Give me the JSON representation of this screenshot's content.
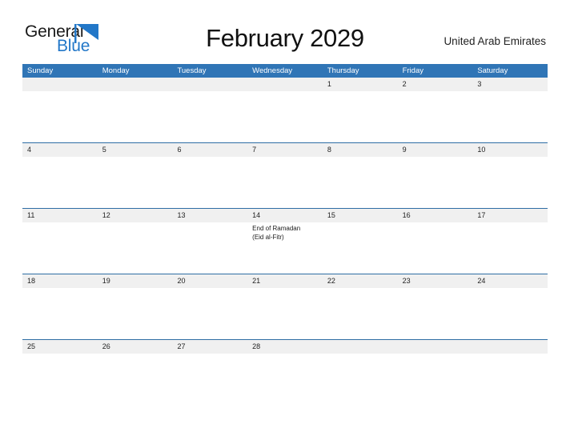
{
  "brand": {
    "name_dark": "General",
    "name_blue": "Blue",
    "flag_icon": "blue-triangle-flag",
    "dark_color": "#1a1a1a",
    "blue_color": "#2277c8"
  },
  "header": {
    "title": "February 2029",
    "country": "United Arab Emirates"
  },
  "theme": {
    "header_blue": "#3075b6",
    "row_divider_blue": "#2e6da4",
    "band_gray": "#f0f0f0",
    "page_background": "#ffffff"
  },
  "calendar": {
    "month": "February",
    "year": "2029",
    "weekdays": [
      "Sunday",
      "Monday",
      "Tuesday",
      "Wednesday",
      "Thursday",
      "Friday",
      "Saturday"
    ],
    "weeks": [
      {
        "days": [
          {
            "number": "",
            "empty": true,
            "events": []
          },
          {
            "number": "",
            "empty": true,
            "events": []
          },
          {
            "number": "",
            "empty": true,
            "events": []
          },
          {
            "number": "",
            "empty": true,
            "events": []
          },
          {
            "number": "1",
            "empty": false,
            "events": []
          },
          {
            "number": "2",
            "empty": false,
            "events": []
          },
          {
            "number": "3",
            "empty": false,
            "events": []
          }
        ]
      },
      {
        "days": [
          {
            "number": "4",
            "empty": false,
            "events": []
          },
          {
            "number": "5",
            "empty": false,
            "events": []
          },
          {
            "number": "6",
            "empty": false,
            "events": []
          },
          {
            "number": "7",
            "empty": false,
            "events": []
          },
          {
            "number": "8",
            "empty": false,
            "events": []
          },
          {
            "number": "9",
            "empty": false,
            "events": []
          },
          {
            "number": "10",
            "empty": false,
            "events": []
          }
        ]
      },
      {
        "days": [
          {
            "number": "11",
            "empty": false,
            "events": []
          },
          {
            "number": "12",
            "empty": false,
            "events": []
          },
          {
            "number": "13",
            "empty": false,
            "events": []
          },
          {
            "number": "14",
            "empty": false,
            "events": [
              "End of Ramadan",
              "(Eid al-Fitr)"
            ]
          },
          {
            "number": "15",
            "empty": false,
            "events": []
          },
          {
            "number": "16",
            "empty": false,
            "events": []
          },
          {
            "number": "17",
            "empty": false,
            "events": []
          }
        ]
      },
      {
        "days": [
          {
            "number": "18",
            "empty": false,
            "events": []
          },
          {
            "number": "19",
            "empty": false,
            "events": []
          },
          {
            "number": "20",
            "empty": false,
            "events": []
          },
          {
            "number": "21",
            "empty": false,
            "events": []
          },
          {
            "number": "22",
            "empty": false,
            "events": []
          },
          {
            "number": "23",
            "empty": false,
            "events": []
          },
          {
            "number": "24",
            "empty": false,
            "events": []
          }
        ]
      },
      {
        "days": [
          {
            "number": "25",
            "empty": false,
            "events": []
          },
          {
            "number": "26",
            "empty": false,
            "events": []
          },
          {
            "number": "27",
            "empty": false,
            "events": []
          },
          {
            "number": "28",
            "empty": false,
            "events": []
          },
          {
            "number": "",
            "empty": true,
            "events": []
          },
          {
            "number": "",
            "empty": true,
            "events": []
          },
          {
            "number": "",
            "empty": true,
            "events": []
          }
        ]
      }
    ]
  }
}
